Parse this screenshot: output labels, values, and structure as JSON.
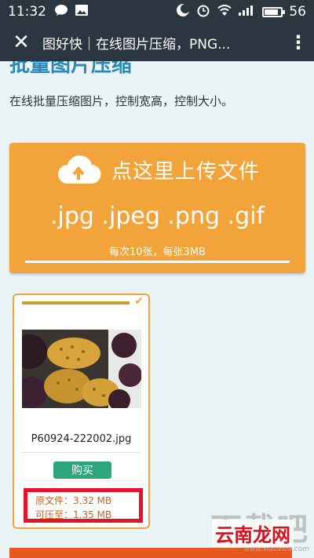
{
  "status_bar": {
    "time": "11:32",
    "signal_label": "56",
    "battery_level": 0.85
  },
  "nav": {
    "title": "图好快｜在线图片压缩，PNG..."
  },
  "page": {
    "clipped_heading": "批量图片压缩",
    "subtitle": "在线批量压缩图片，控制宽高，控制大小。"
  },
  "upload": {
    "label": "点这里上传文件",
    "formats": ".jpg .jpeg .png .gif",
    "limits": "每次10张，每张3MB"
  },
  "file_card": {
    "filename": "P60924-222002.jpg",
    "buy_label": "购买",
    "original_label": "原文件：3.32 MB",
    "compressed_label": "可压至：1.35 MB"
  },
  "watermark": {
    "site_text": "下载吧",
    "brand_text": "云南龙网",
    "url": "www.xiazaiba.com"
  },
  "colors": {
    "accent_orange": "#f2a33a",
    "buy_green": "#2ea67c",
    "highlight_red": "#e5122a",
    "status_bar": "#2c3640"
  }
}
